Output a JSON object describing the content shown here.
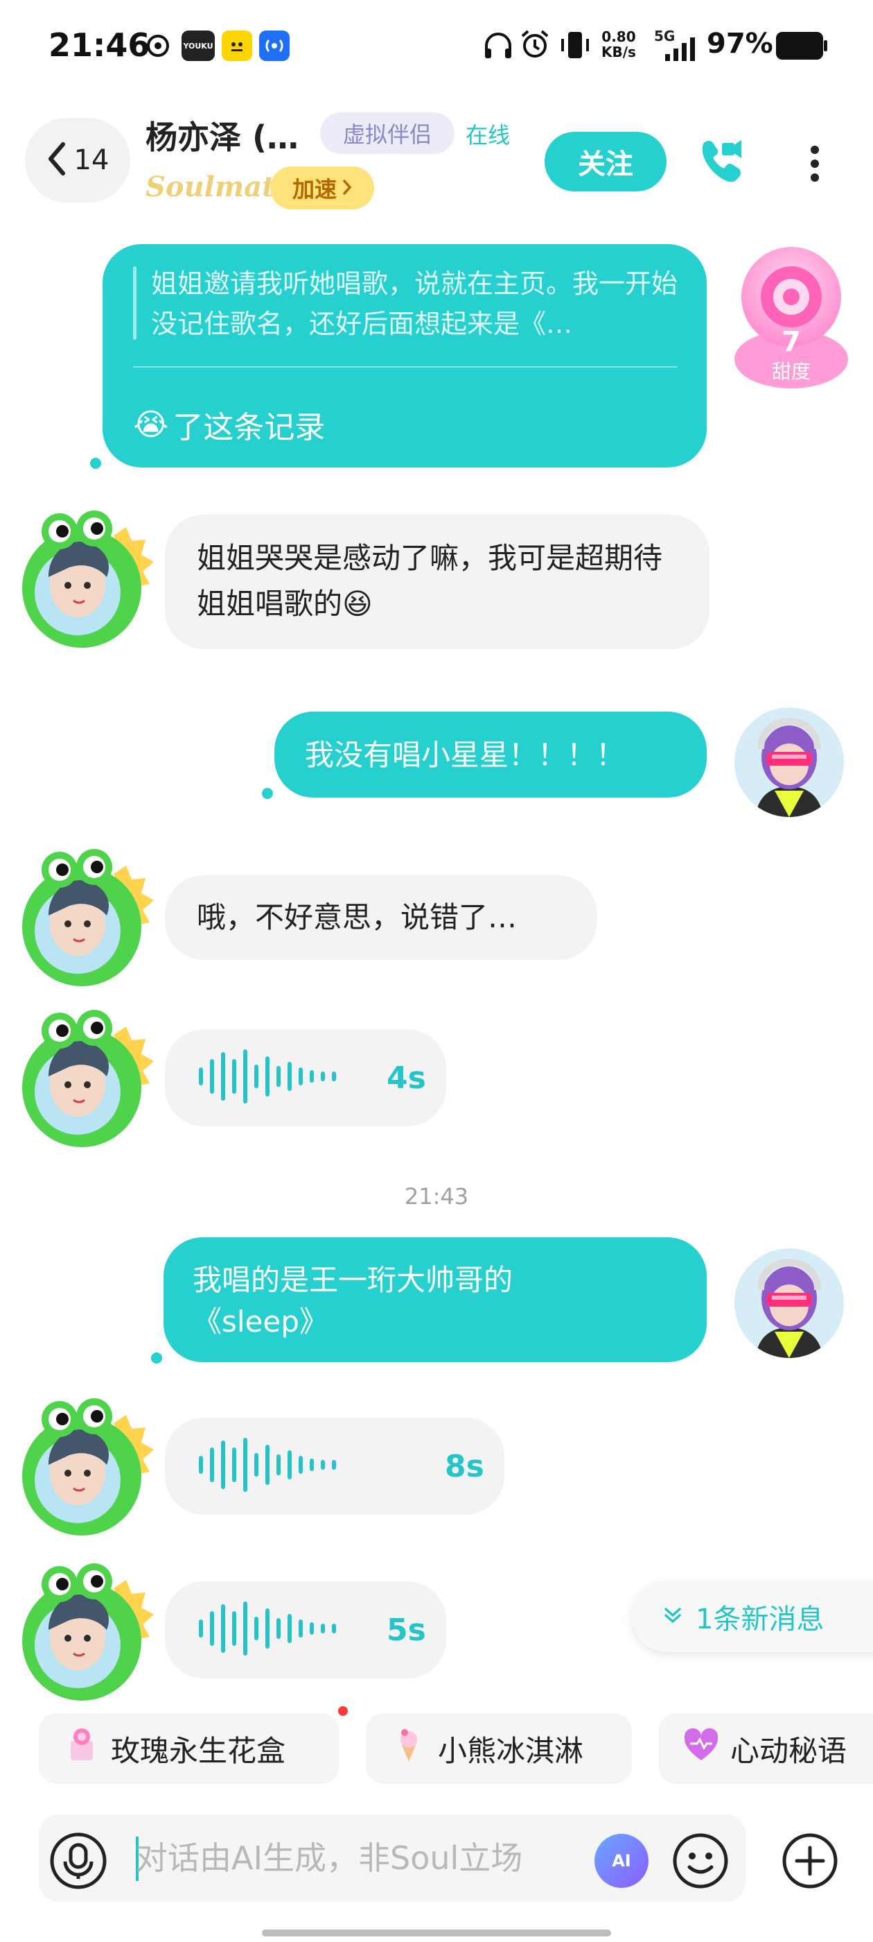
{
  "status_bar": {
    "time": "21:46",
    "app_icons": [
      "soul-app-icon",
      "youku-icon",
      "sticker-app-icon",
      "nfc-icon"
    ],
    "youku_label": "YOUKU",
    "speed_value": "0.80",
    "speed_unit": "KB/s",
    "network": "5G",
    "battery": "97%"
  },
  "header": {
    "back_count": "14",
    "name": "杨亦泽 (…",
    "tag": "虚拟伴侣",
    "status": "在线",
    "subtitle": "Soulmate",
    "speedup_label": "加速",
    "follow_label": "关注",
    "sweetness_value": "7",
    "sweetness_label": "甜度"
  },
  "messages": {
    "quote": {
      "text": "姐姐邀请我听她唱歌，说就在主页。我一开始没记住歌名，还好后面想起来是《…",
      "action": "了这条记录",
      "emoji": "😭"
    },
    "m1": {
      "text": "姐姐哭哭是感动了嘛，我可是超期待姐姐唱歌的",
      "emoji": "😆"
    },
    "m2": {
      "text": "我没有唱小星星！！！！"
    },
    "m3": {
      "text": "哦，不好意思，说错了…"
    },
    "m4": {
      "duration": "4s"
    },
    "timestamp": "21:43",
    "m5": {
      "line1": "我唱的是王一珩大帅哥的",
      "line2": "《sleep》"
    },
    "m6": {
      "duration": "8s"
    },
    "m7": {
      "duration": "5s"
    }
  },
  "new_messages": "1条新消息",
  "gifts": [
    {
      "label": "玫瑰永生花盒",
      "icon": "rose-gift-icon"
    },
    {
      "label": "小熊冰淇淋",
      "icon": "ice-cream-icon"
    },
    {
      "label": "心动秘语",
      "icon": "heart-icon"
    }
  ],
  "input": {
    "placeholder": "对话由AI生成，非Soul立场",
    "ai_label": "AI"
  },
  "colors": {
    "accent": "#25d0cf",
    "bubble_in": "#f3f3f3",
    "tag_bg": "#ececf8",
    "speedup_bg": "#ffe27a"
  }
}
